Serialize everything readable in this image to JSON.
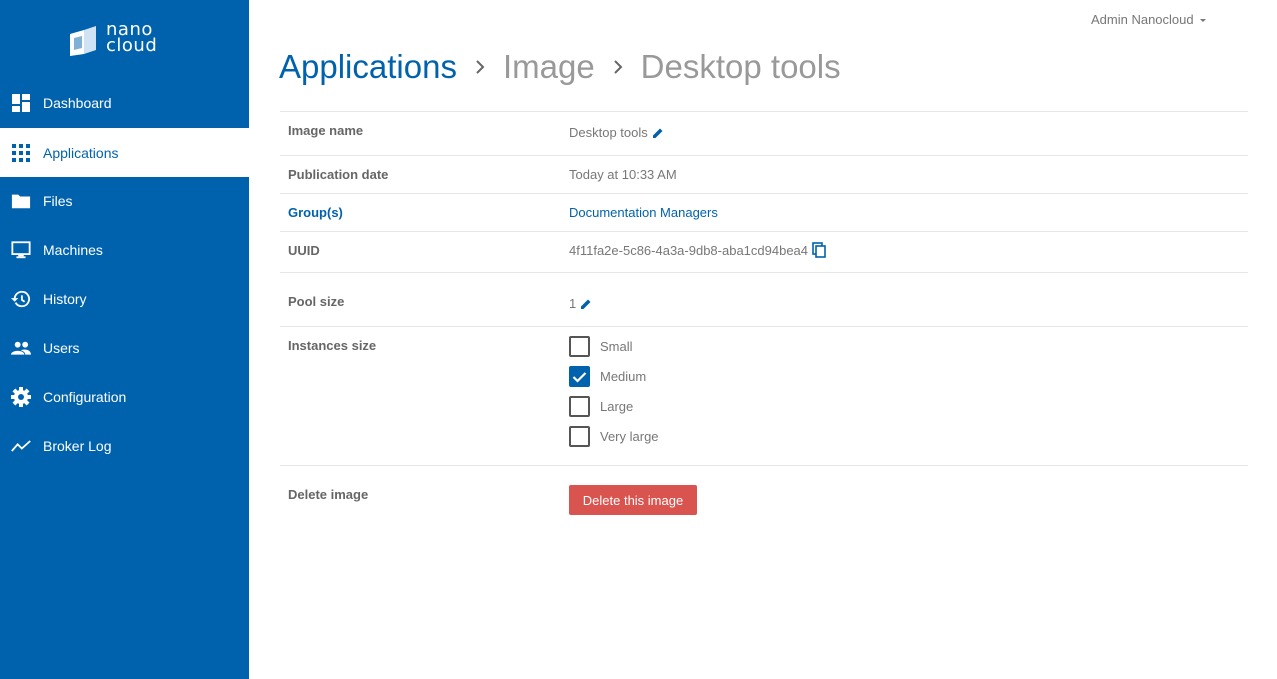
{
  "app": {
    "logo_line1": "nano",
    "logo_line2": "cloud"
  },
  "sidebar": {
    "items": [
      {
        "label": "Dashboard",
        "icon": "dashboard-icon"
      },
      {
        "label": "Applications",
        "icon": "apps-grid-icon",
        "active": true
      },
      {
        "label": "Files",
        "icon": "folder-icon"
      },
      {
        "label": "Machines",
        "icon": "monitor-icon"
      },
      {
        "label": "History",
        "icon": "history-icon"
      },
      {
        "label": "Users",
        "icon": "users-icon"
      },
      {
        "label": "Configuration",
        "icon": "gear-icon"
      },
      {
        "label": "Broker Log",
        "icon": "trend-line-icon"
      }
    ]
  },
  "header": {
    "user": "Admin Nanocloud"
  },
  "breadcrumb": [
    "Applications",
    "Image",
    "Desktop tools"
  ],
  "details": {
    "image_name_label": "Image name",
    "image_name_value": "Desktop tools",
    "publication_label": "Publication date",
    "publication_value": "Today at 10:33 AM",
    "groups_label": "Group(s)",
    "groups_value": "Documentation Managers",
    "uuid_label": "UUID",
    "uuid_value": "4f11fa2e-5c86-4a3a-9db8-aba1cd94bea4",
    "pool_label": "Pool size",
    "pool_value": "1",
    "instances_label": "Instances size",
    "instances": [
      {
        "label": "Small",
        "checked": false
      },
      {
        "label": "Medium",
        "checked": true
      },
      {
        "label": "Large",
        "checked": false
      },
      {
        "label": "Very large",
        "checked": false
      }
    ],
    "delete_label": "Delete image",
    "delete_button": "Delete this image"
  },
  "colors": {
    "brand": "#0062ad",
    "danger": "#d9534f"
  }
}
